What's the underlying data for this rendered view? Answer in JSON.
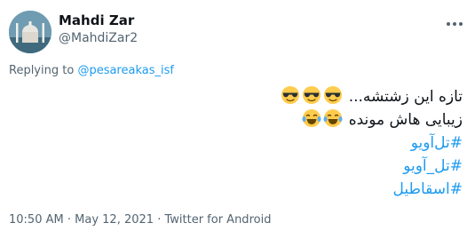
{
  "author": {
    "name": "Mahdi Zar",
    "handle": "@MahdiZar2"
  },
  "reply": {
    "prefix": "Replying to",
    "mention": "@pesareakas_isf"
  },
  "tweet": {
    "line1_text": "تازه این زشتشه...",
    "line1_emoji": [
      "sunglasses-emoji",
      "sunglasses-emoji",
      "sunglasses-emoji"
    ],
    "line2_text": "زیبایی هاش مونده",
    "line2_emoji": [
      "tears-of-joy-emoji",
      "tears-of-joy-emoji"
    ],
    "hashtags": [
      "#تل‌آویو",
      "#تل_آویو",
      "#اسقاطیل"
    ]
  },
  "meta": {
    "time": "10:50 AM",
    "date": "May 12, 2021",
    "source": "Twitter for Android",
    "separator": "·"
  },
  "colors": {
    "link": "#1d9bf0",
    "muted": "#536471",
    "text": "#0f1419"
  },
  "icons": {
    "more": "more-icon"
  }
}
